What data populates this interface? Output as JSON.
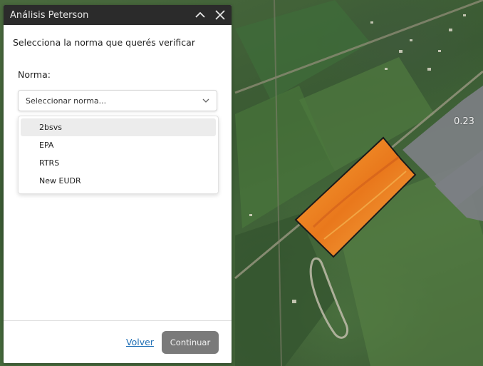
{
  "panel": {
    "title": "Análisis Peterson",
    "subtitle": "Selecciona la norma que querés verificar",
    "field_label": "Norma:",
    "select_placeholder": "Seleccionar norma...",
    "options": [
      {
        "label": "2bsvs",
        "highlighted": true
      },
      {
        "label": "EPA",
        "highlighted": false
      },
      {
        "label": "RTRS",
        "highlighted": false
      },
      {
        "label": "New EUDR",
        "highlighted": false
      }
    ],
    "back_link": "Volver",
    "continue_button": "Continuar"
  },
  "map": {
    "plot_value_label": "0.23",
    "colors": {
      "gray_plot": "#7c7f83",
      "selected_plot": "#f2942a",
      "header": "#2b2b2b",
      "link": "#1f6fb5",
      "button": "#7a7a7a"
    }
  },
  "icons": [
    "chevron-up-icon",
    "close-icon",
    "chevron-down-icon"
  ]
}
